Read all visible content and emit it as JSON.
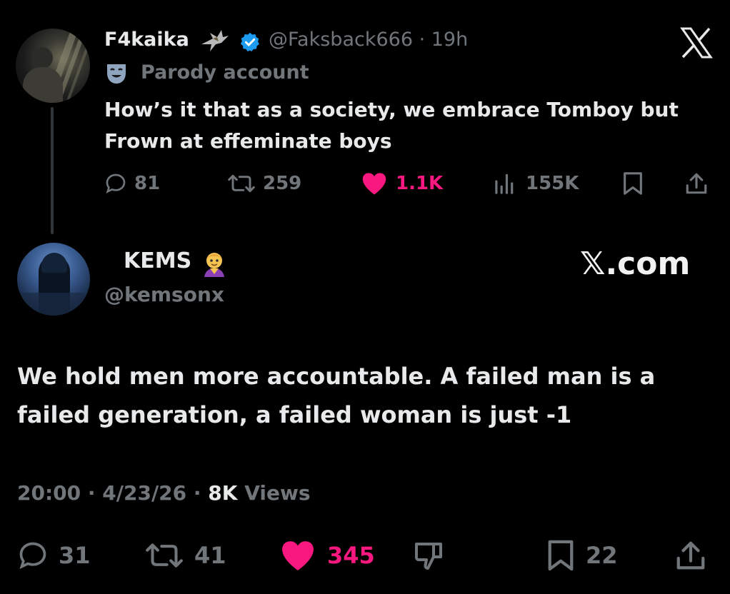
{
  "parent_tweet": {
    "display_name": "F4kaika",
    "handle": "@Faksback666",
    "time": "· 19h",
    "badge": "Parody account",
    "text": "How’s it that as a society, we embrace Tomboy but Frown at effeminate boys",
    "actions": {
      "replies": "81",
      "reposts": "259",
      "likes": "1.1K",
      "views": "155K"
    },
    "colors": {
      "like": "#f91880",
      "verified": "#1d9bf0",
      "muted": "#71767b"
    }
  },
  "reply_tweet": {
    "display_name": "KEMS",
    "handle": "@kemsonx",
    "watermark": "𝕏.com",
    "text": "We hold men more accountable. A failed man is a failed generation, a failed woman is just -1",
    "meta": {
      "time": "20:00",
      "date": "4/23/26",
      "views_count": "8K",
      "views_label": "Views"
    },
    "actions": {
      "replies": "31",
      "reposts": "41",
      "likes": "345",
      "bookmarks": "22"
    }
  },
  "icons": [
    "x-logo-icon",
    "verified-badge-icon",
    "eagle-emoji-icon",
    "parody-mask-icon",
    "reply-icon",
    "repost-icon",
    "like-icon",
    "views-icon",
    "bookmark-icon",
    "share-icon",
    "dislike-icon",
    "mage-emoji-icon"
  ]
}
